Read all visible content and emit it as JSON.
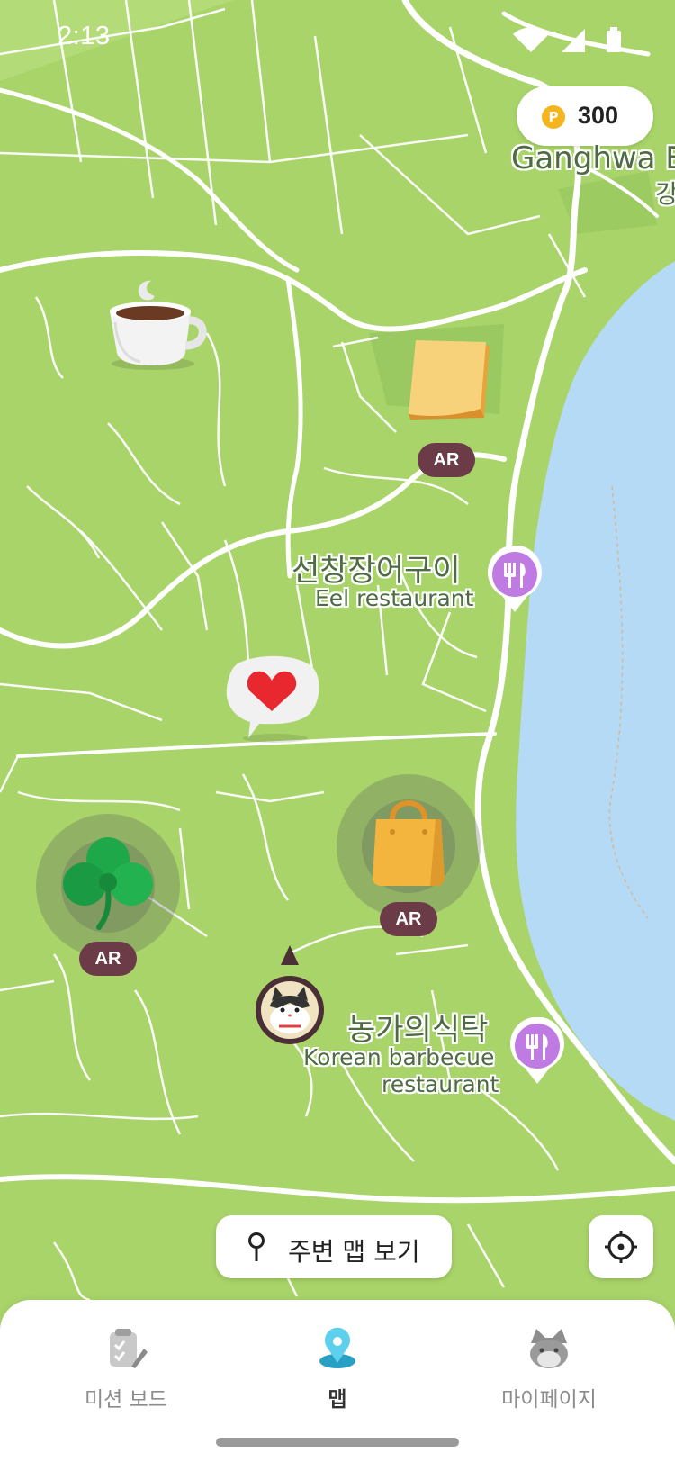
{
  "status_bar": {
    "time": "2:13"
  },
  "points": {
    "value": "300",
    "coin_symbol": "P"
  },
  "map_labels": {
    "area_name": "Ganghwa B",
    "area_name_ko": "강",
    "place1_ko": "선창장어구이",
    "place1_en": "Eel restaurant",
    "place2_ko": "농가의식탁",
    "place2_en_line1": "Korean barbecue",
    "place2_en_line2": "restaurant"
  },
  "markers": {
    "note_ar": "AR",
    "bag_ar": "AR",
    "clover_ar": "AR"
  },
  "near_map_button": {
    "label": "주변 맵 보기"
  },
  "bottom_nav": {
    "items": [
      {
        "label": "미션 보드",
        "icon": "clipboard-icon",
        "active": false
      },
      {
        "label": "맵",
        "icon": "map-pin-icon",
        "active": true
      },
      {
        "label": "마이페이지",
        "icon": "cat-face-icon",
        "active": false
      }
    ]
  },
  "colors": {
    "land": "#a9d46a",
    "water": "#b5daf5",
    "road": "#ffffff",
    "ar_badge": "#6b3c48",
    "active_nav": "#3fb7d9",
    "coin": "#f4b51f",
    "restaurant_pin": "#c07be3"
  }
}
